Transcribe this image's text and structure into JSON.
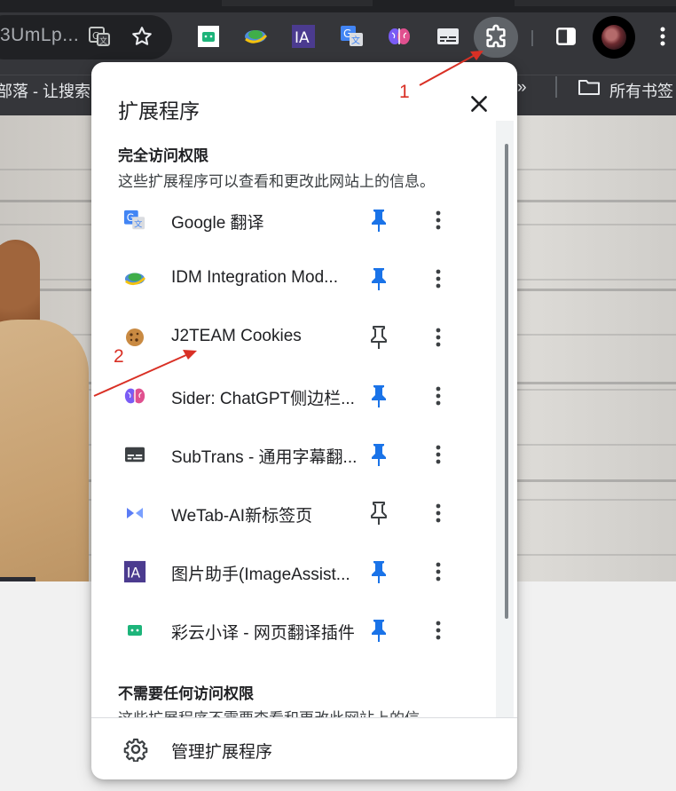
{
  "browser": {
    "url_fragment": "3UmLp...",
    "extensions_button_label": "扩展程序",
    "bookmark_left": "部落 - 让搜索更",
    "bookmark_overflow": "»",
    "bookmark_all": "所有书签"
  },
  "popup": {
    "title": "扩展程序",
    "full_access": {
      "heading": "完全访问权限",
      "description": "这些扩展程序可以查看和更改此网站上的信息。"
    },
    "extensions": [
      {
        "name": "Google 翻译",
        "icon": "google-translate-icon",
        "pinned": true
      },
      {
        "name": "IDM Integration Mod...",
        "icon": "idm-icon",
        "pinned": true
      },
      {
        "name": "J2TEAM Cookies",
        "icon": "cookie-icon",
        "pinned": false
      },
      {
        "name": "Sider: ChatGPT侧边栏...",
        "icon": "sider-brain-icon",
        "pinned": true
      },
      {
        "name": "SubTrans - 通用字幕翻...",
        "icon": "subtitle-icon",
        "pinned": true
      },
      {
        "name": "WeTab-AI新标签页",
        "icon": "wetab-icon",
        "pinned": false
      },
      {
        "name": "图片助手(ImageAssist...",
        "icon": "image-assistant-icon",
        "pinned": true
      },
      {
        "name": "彩云小译 - 网页翻译插件",
        "icon": "caiyun-icon",
        "pinned": true
      }
    ],
    "no_access": {
      "heading": "不需要任何访问权限",
      "description": "这些扩展程序不需要查看和更改此网站上的信"
    },
    "footer_label": "管理扩展程序"
  },
  "annotations": {
    "one": "1",
    "two": "2"
  },
  "colors": {
    "pin_active": "#1a73e8",
    "pin_inactive": "#5f6368",
    "annotation": "#d93025"
  }
}
